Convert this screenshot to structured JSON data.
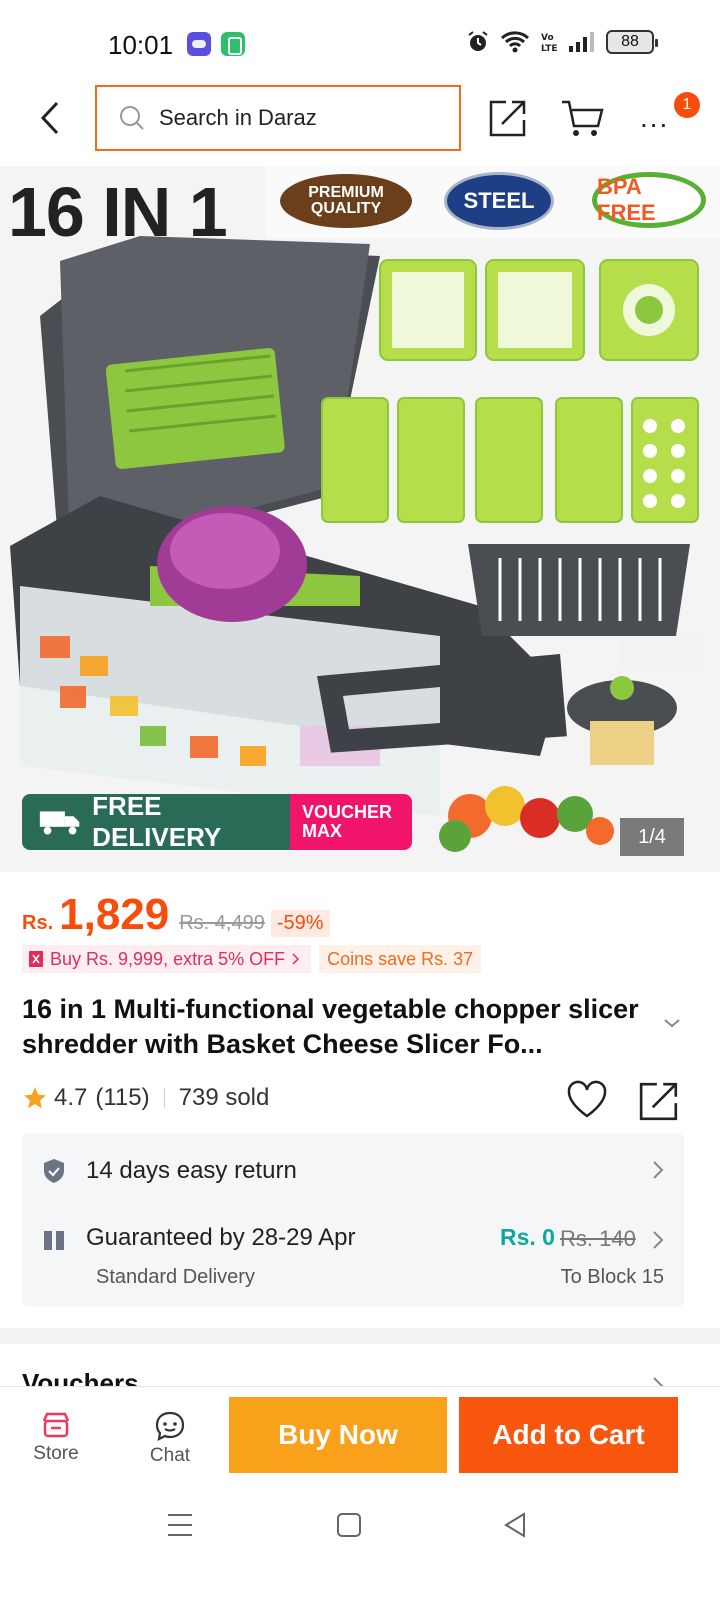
{
  "status_bar": {
    "time": "10:01",
    "battery": "88",
    "icons": [
      "alarm-icon",
      "wifi-icon",
      "volte-icon",
      "signal-icon",
      "battery-icon"
    ]
  },
  "nav": {
    "search_placeholder": "Search in Daraz",
    "cart_badge": "1",
    "more_label": "..."
  },
  "gallery": {
    "headline": "16 IN 1",
    "badges": {
      "premium": "PREMIUM QUALITY",
      "steel": "STEEL",
      "bpa": "BPA FREE"
    },
    "promo_free_delivery": "FREE DELIVERY",
    "promo_voucher_line1": "VOUCHER",
    "promo_voucher_line2": "MAX",
    "counter": "1/4"
  },
  "price": {
    "currency": "Rs.",
    "current": "1,829",
    "original": "Rs. 4,499",
    "discount": "-59%"
  },
  "promotions": {
    "buy_offer": "Buy Rs. 9,999, extra 5% OFF",
    "coins": "Coins save Rs. 37"
  },
  "product": {
    "title": "16 in 1 Multi-functional vegetable chopper slicer shredder with Basket Cheese Slicer Fo...",
    "rating": "4.7",
    "reviews": "(115)",
    "sold": "739 sold"
  },
  "service": {
    "return_policy": "14 days easy return",
    "delivery_guarantee": "Guaranteed by 28-29 Apr",
    "delivery_type": "Standard Delivery",
    "delivery_fee": "Rs. 0",
    "delivery_fee_original": "Rs. 140",
    "delivery_location": "To Block 15"
  },
  "vouchers": {
    "title": "Vouchers"
  },
  "actions": {
    "store_label": "Store",
    "chat_label": "Chat",
    "buy_now": "Buy Now",
    "add_to_cart": "Add to Cart"
  },
  "colors": {
    "brand_orange": "#f84d0a",
    "buy_now_bg": "#f9a11b",
    "free_delivery_bg": "#2a6b58",
    "voucher_bg": "#f0146b",
    "delivery_fee_color": "#12a6a0"
  }
}
